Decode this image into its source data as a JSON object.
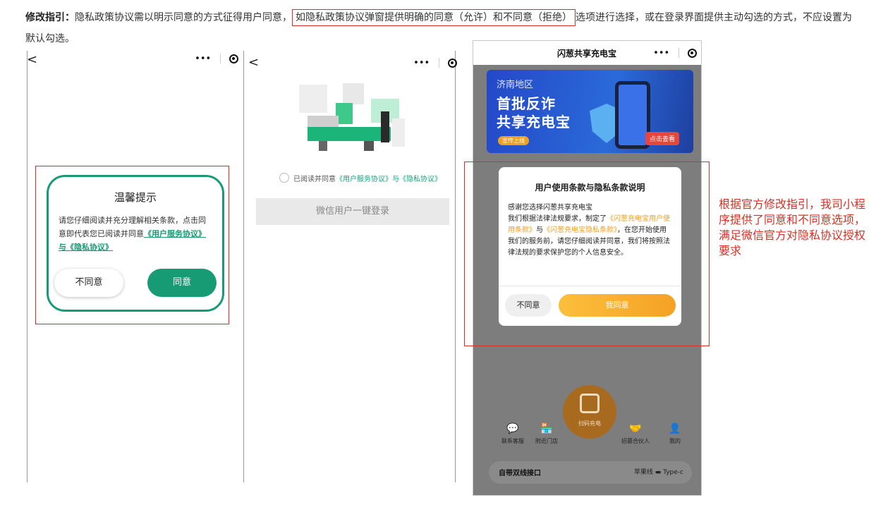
{
  "guide": {
    "label": "修改指引",
    "colon": "：",
    "text_before": "隐私政策协议需以明示同意的方式征得用户同意，",
    "highlight": "如隐私政策协议弹窗提供明确的同意（允许）和不同意（拒绝）",
    "text_after": "选项进行选择，或在登录界面提供主动勾选的方式，不应设置为默认勾选。"
  },
  "nav": {
    "back_glyph": "<",
    "menu_glyph": "•••"
  },
  "phone1": {
    "dialog_title": "温馨提示",
    "dialog_body": "请您仔细阅读并充分理解相关条款，点击同意即代表您已阅读并同意",
    "dialog_link": "《用户服务协议》与《隐私协议》",
    "btn_disagree": "不同意",
    "btn_agree": "同意"
  },
  "phone2": {
    "agree_prefix": "已阅读并同意",
    "agree_link": "《用户服务协议》与《隐私协议》",
    "login_button": "微信用户一键登录"
  },
  "phone3": {
    "nav_title": "闪葱共享充电宝",
    "banner_subtitle": "济南地区",
    "banner_line1": "首批反诈",
    "banner_line2": "共享充电宝",
    "banner_tag": "宣传上线",
    "banner_cta": "点击查看",
    "dialog_title": "用户使用条款与隐私条款说明",
    "dialog_greeting": "感谢您选择闪葱共享充电宝",
    "dialog_p1": "我们根据法律法规要求，制定了",
    "dialog_link1": "《闪葱充电宝用户使用条款》",
    "dialog_and": "与",
    "dialog_link2": "《闪葱充电宝隐私条款》",
    "dialog_p2": "，在您开始使用我们的服务前，请您仔细阅读并同意，我们将按照法律法规的要求保护您的个人信息安全。",
    "btn_disagree": "不同意",
    "btn_agree": "我同意",
    "scan_label": "扫码充电",
    "tabs": [
      {
        "label": "联系客服",
        "icon": "chat-icon",
        "glyph": "💬"
      },
      {
        "label": "附近门店",
        "icon": "store-icon",
        "glyph": "🏪"
      },
      {
        "label": "招募合伙人",
        "icon": "handshake-icon",
        "glyph": "🤝"
      },
      {
        "label": "我的",
        "icon": "user-icon",
        "glyph": "👤"
      }
    ],
    "bottom_left": "自带双线接口",
    "bottom_right": "苹果线 ▬ Type-c"
  },
  "note": "根据官方修改指引，我司小程序提供了同意和不同意选项，满足微信官方对隐私协议授权要求",
  "colors": {
    "annotation_red": "#d93025",
    "green_accent": "#179b74",
    "orange_accent": "#f4a224"
  }
}
